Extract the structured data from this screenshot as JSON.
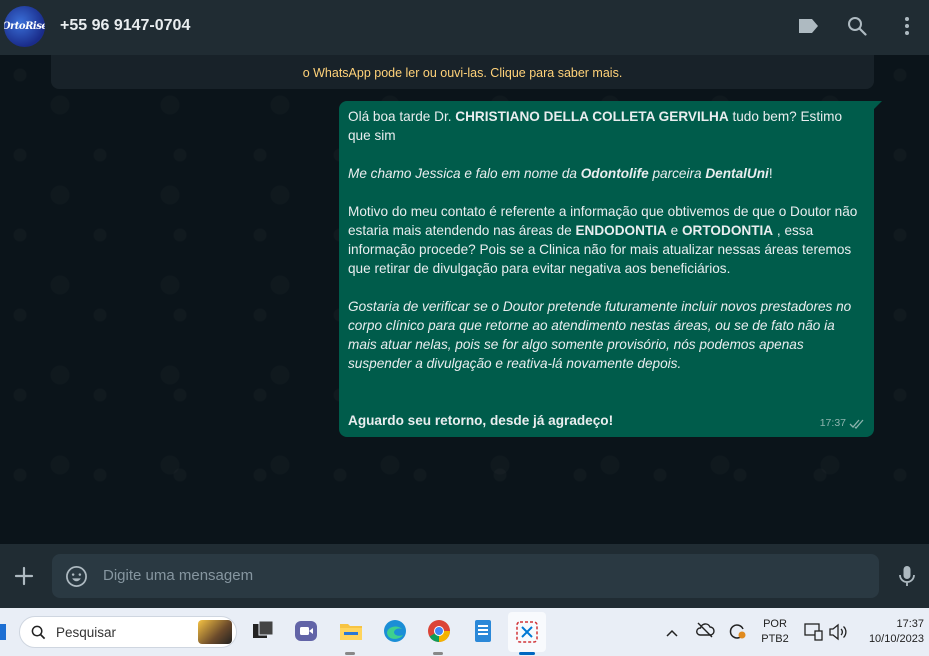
{
  "header": {
    "avatar_text": "OrtoRise",
    "contact": "+55 96 9147-0704"
  },
  "encryption_banner": {
    "text": "o WhatsApp pode ler ou ouvi-las. Clique para saber mais."
  },
  "message": {
    "p1_a": "Olá boa tarde Dr. ",
    "p1_b": "CHRISTIANO DELLA COLLETA GERVILHA",
    "p1_c": " tudo bem? Estimo que sim",
    "p2_a": "Me chamo Jessica e falo em nome da ",
    "p2_b": "Odontolife",
    "p2_c": " parceira ",
    "p2_d": "DentalUni",
    "p2_e": "!",
    "p3_a": "Motivo do meu contato é referente a informação que obtivemos de que o Doutor não estaria mais atendendo nas áreas de ",
    "p3_b": "ENDODONTIA",
    "p3_c": " e ",
    "p3_d": "ORTODONTIA",
    "p3_e": " , essa informação procede? Pois se a Clinica não for mais atualizar nessas áreas teremos que retirar de divulgação para evitar negativa aos beneficiários.",
    "p4": "Gostaria de verificar se o Doutor pretende futuramente incluir novos prestadores no corpo clínico para que retorne ao atendimento nestas áreas, ou se de fato não ia mais atuar nelas, pois se for algo somente provisório, nós podemos apenas suspender a divulgação e reativa-lá novamente depois.",
    "p5": "Aguardo seu retorno, desde já agradeço!",
    "time": "17:37"
  },
  "input": {
    "placeholder": "Digite uma mensagem"
  },
  "taskbar": {
    "search_label": "Pesquisar",
    "lang_line1": "POR",
    "lang_line2": "PTB2",
    "clock_time": "17:37",
    "clock_date": "10/10/2023"
  },
  "colors": {
    "header_bg": "#202c33",
    "chat_bg": "#0b141a",
    "outgoing_bubble": "#005c4b",
    "banner_text": "#ffd279",
    "taskbar_bg": "#e9eef6"
  }
}
